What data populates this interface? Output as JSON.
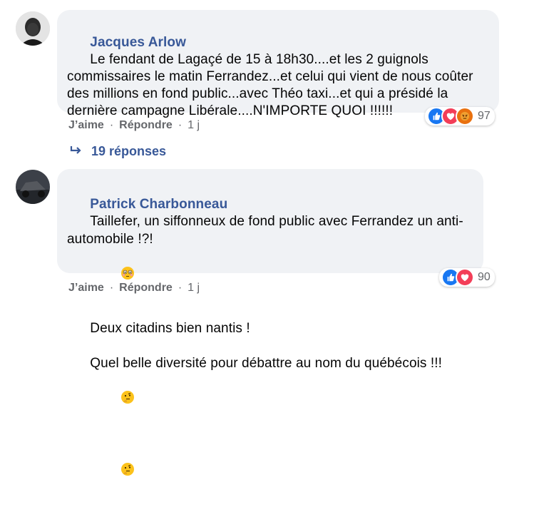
{
  "comments": [
    {
      "author": "Jacques Arlow",
      "text": "Le fendant de Lagaçé de 15 à 18h30....et les 2 guignols commissaires le matin Ferrandez...et celui qui vient de nous coûter des millions en fond public...avec Théo taxi...et qui a présidé la dernière campagne Libérale....N'IMPORTE QUOI !!!!!!",
      "like_label": "J’aime",
      "reply_label": "Répondre",
      "time": "1 j",
      "reaction_count": "97",
      "reactions": [
        "like-icon",
        "love-icon",
        "angry-icon"
      ],
      "replies_label": "19 réponses"
    },
    {
      "author": "Patrick Charbonneau",
      "line1": "Taillefer, un siffonneux de fond public avec Ferrandez un anti-automobile !?!",
      "line2": "Deux citadins bien nantis !",
      "line3": "Quel belle diversité pour débattre au nom du québécois !!!",
      "like_label": "J’aime",
      "reply_label": "Répondre",
      "time": "1 j",
      "reaction_count": "90",
      "reactions": [
        "like-icon",
        "love-icon"
      ]
    }
  ],
  "colors": {
    "bubble": "#f0f2f5",
    "author": "#385898",
    "meta": "#65676b",
    "like": "#1877f2",
    "love": "#f33e58",
    "angry": "#e9710f"
  }
}
